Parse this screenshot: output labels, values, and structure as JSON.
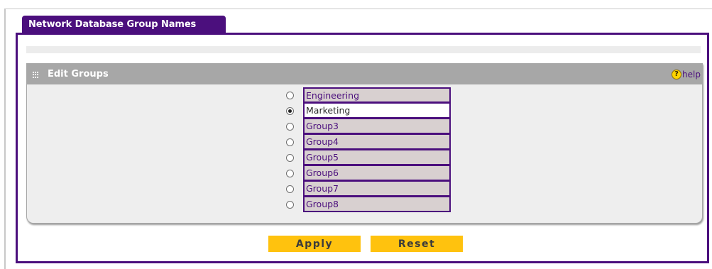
{
  "tab": {
    "label": "Network Database Group Names"
  },
  "edit_groups": {
    "title": "Edit Groups",
    "help_label": "help",
    "selected_index": 1,
    "groups": [
      "Engineering",
      "Marketing",
      "Group3",
      "Group4",
      "Group5",
      "Group6",
      "Group7",
      "Group8"
    ]
  },
  "buttons": {
    "apply_label": "Apply",
    "reset_label": "Reset"
  },
  "colors": {
    "tab_bg": "#4b0f7d",
    "section_header_bg": "#a7a7a7",
    "button_bg": "#ffc20e",
    "field_bg": "#d8d0d0",
    "help_icon": "#ffd400"
  },
  "icons": {
    "section": "grid-dots-icon",
    "help": "question-circle-icon"
  }
}
